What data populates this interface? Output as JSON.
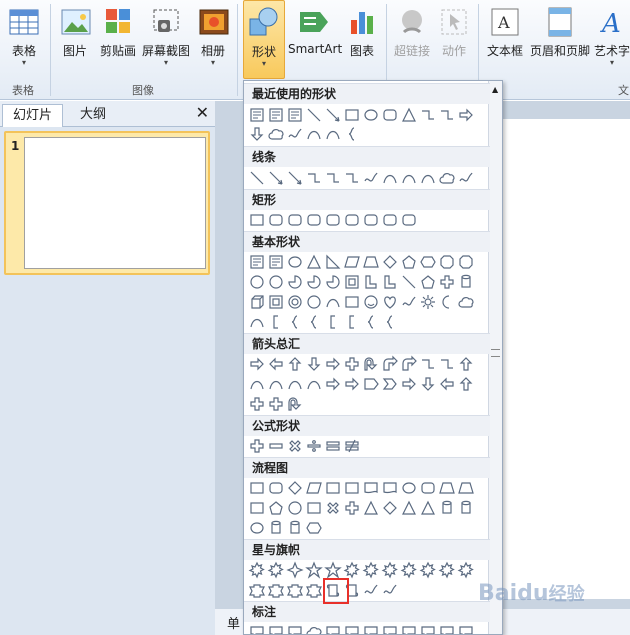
{
  "ribbon": {
    "buttons": [
      {
        "id": "table",
        "label": "表格",
        "icon": "table-icon",
        "dd": "▾"
      },
      {
        "id": "picture",
        "label": "图片",
        "icon": "picture-icon",
        "dd": ""
      },
      {
        "id": "clipart",
        "label": "剪贴画",
        "icon": "clipart-icon",
        "dd": ""
      },
      {
        "id": "screenshot",
        "label": "屏幕截图",
        "icon": "screenshot-icon",
        "dd": "▾"
      },
      {
        "id": "album",
        "label": "相册",
        "icon": "album-icon",
        "dd": "▾"
      },
      {
        "id": "shapes",
        "label": "形状",
        "icon": "shapes-icon",
        "dd": "▾"
      },
      {
        "id": "smartart",
        "label": "SmartArt",
        "icon": "smartart-icon",
        "dd": ""
      },
      {
        "id": "chart",
        "label": "图表",
        "icon": "chart-icon",
        "dd": ""
      },
      {
        "id": "hyperlink",
        "label": "超链接",
        "icon": "hyperlink-icon",
        "dd": ""
      },
      {
        "id": "action",
        "label": "动作",
        "icon": "action-icon",
        "dd": ""
      },
      {
        "id": "textbox",
        "label": "文本框",
        "icon": "textbox-icon",
        "dd": ""
      },
      {
        "id": "headerfooter",
        "label": "页眉和页脚",
        "icon": "header-footer-icon",
        "dd": ""
      },
      {
        "id": "wordart",
        "label": "艺术字",
        "icon": "wordart-icon",
        "dd": "▾"
      }
    ],
    "groups": {
      "table": "表格",
      "images": "图像",
      "text": "文"
    }
  },
  "left_pane": {
    "tabs": [
      "幻灯片",
      "大纲"
    ],
    "close": "✕",
    "slide_number": "1"
  },
  "gallery": {
    "categories": [
      "最近使用的形状",
      "线条",
      "矩形",
      "基本形状",
      "箭头总汇",
      "公式形状",
      "流程图",
      "星与旗帜",
      "标注"
    ],
    "status_fragment": "单"
  },
  "watermark": "Baidu经验"
}
